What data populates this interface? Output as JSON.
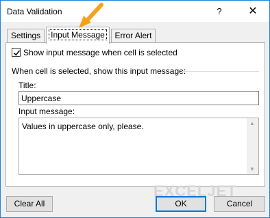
{
  "window": {
    "title": "Data Validation",
    "help_glyph": "?",
    "close_glyph": "✕"
  },
  "tabs": [
    {
      "label": "Settings"
    },
    {
      "label": "Input Message",
      "selected": true
    },
    {
      "label": "Error Alert"
    }
  ],
  "options": {
    "show_input_message_label": "Show input message when cell is selected",
    "show_input_message_checked": true
  },
  "group": {
    "heading": "When cell is selected, show this input message:"
  },
  "fields": {
    "title_label": "Title:",
    "title_value": "Uppercase",
    "message_label": "Input message:",
    "message_value": "Values in uppercase only, please."
  },
  "watermark": {
    "text": "EXCELJET"
  },
  "buttons": {
    "clear_all": "Clear All",
    "ok": "OK",
    "cancel": "Cancel"
  },
  "colors": {
    "accent": "#0078d7",
    "window_border": "#1883d7",
    "annotation_arrow": "#f5a21a",
    "watermark_orange": "#f5a21a"
  },
  "icons": [
    "checkmark-icon",
    "close-icon",
    "help-icon",
    "scroll-up-icon",
    "scroll-down-icon",
    "annotation-arrow-icon"
  ]
}
